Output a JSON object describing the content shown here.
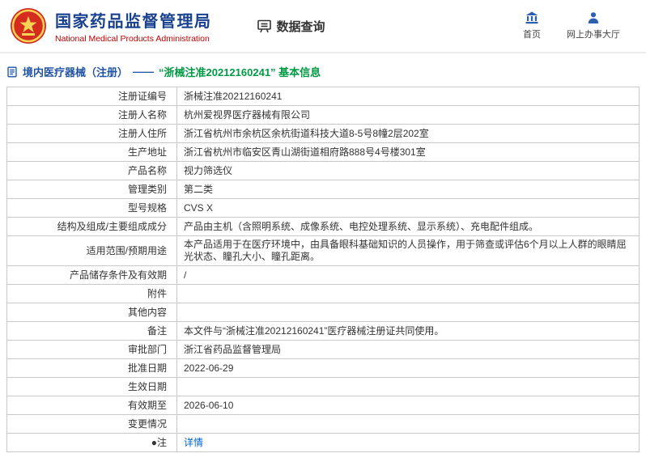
{
  "header": {
    "org_name_cn": "国家药品监督管理局",
    "org_name_en": "National Medical Products Administration",
    "data_query_label": "数据查询",
    "nav": [
      {
        "label": "首页",
        "icon": "home-icon"
      },
      {
        "label": "网上办事大厅",
        "icon": "user-icon"
      }
    ]
  },
  "breadcrumb": {
    "section": "境内医疗器械（注册）",
    "separator": "——",
    "title": "“浙械注准20212160241” 基本信息"
  },
  "colors": {
    "brand_blue": "#19418e",
    "brand_red": "#c30000",
    "emblem_red": "#d42c1f",
    "emblem_gold": "#f7d353",
    "breadcrumb_blue": "#2053a3",
    "breadcrumb_green": "#009944",
    "link_blue": "#0066cc",
    "icon_blue": "#2b5fb0"
  },
  "table": {
    "rows": [
      {
        "label": "注册证编号",
        "value": "浙械注准20212160241"
      },
      {
        "label": "注册人名称",
        "value": "杭州爱视界医疗器械有限公司"
      },
      {
        "label": "注册人住所",
        "value": "浙江省杭州市余杭区余杭街道科技大道8-5号8幢2层202室"
      },
      {
        "label": "生产地址",
        "value": "浙江省杭州市临安区青山湖街道相府路888号4号楼301室"
      },
      {
        "label": "产品名称",
        "value": "视力筛选仪"
      },
      {
        "label": "管理类别",
        "value": "第二类"
      },
      {
        "label": "型号规格",
        "value": "CVS X"
      },
      {
        "label": "结构及组成/主要组成成分",
        "value": "产品由主机（含照明系统、成像系统、电控处理系统、显示系统）、充电配件组成。"
      },
      {
        "label": "适用范围/预期用途",
        "value": "本产品适用于在医疗环境中，由具备眼科基础知识的人员操作，用于筛查或评估6个月以上人群的眼睛屈光状态、瞳孔大小、瞳孔距离。"
      },
      {
        "label": "产品储存条件及有效期",
        "value": "/"
      },
      {
        "label": "附件",
        "value": ""
      },
      {
        "label": "其他内容",
        "value": ""
      },
      {
        "label": "备注",
        "value": "本文件与“浙械注准20212160241”医疗器械注册证共同使用。"
      },
      {
        "label": "审批部门",
        "value": "浙江省药品监督管理局"
      },
      {
        "label": "批准日期",
        "value": "2022-06-29"
      },
      {
        "label": "生效日期",
        "value": ""
      },
      {
        "label": "有效期至",
        "value": "2026-06-10"
      },
      {
        "label": "变更情况",
        "value": ""
      },
      {
        "label": "●注",
        "value": "详情",
        "link": true
      }
    ]
  }
}
